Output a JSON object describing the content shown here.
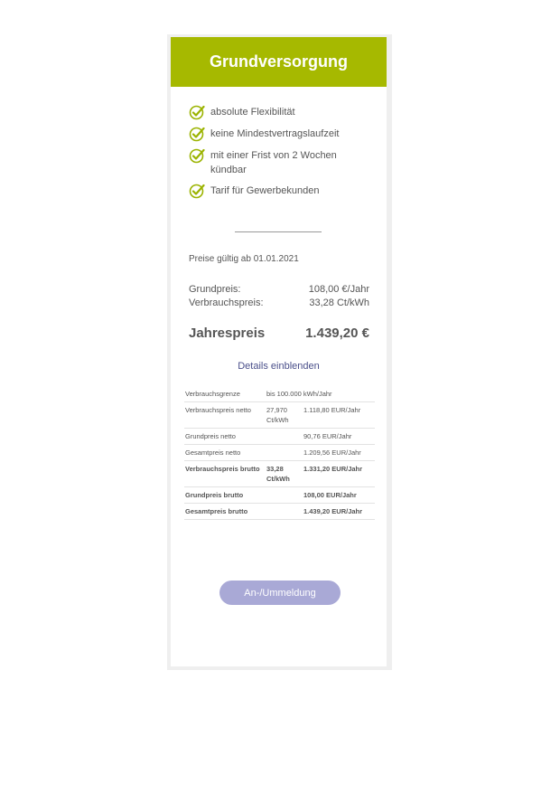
{
  "tariff": {
    "title": "Grundversorgung",
    "features": [
      {
        "label": "absolute Flexibilität"
      },
      {
        "label": "keine Mindestvertragslaufzeit"
      },
      {
        "label": "mit einer Frist von 2 Wochen kündbar"
      },
      {
        "label": "Tarif für Gewerbekunden"
      }
    ],
    "valid_from": "Preise gültig ab 01.01.2021",
    "base_price": {
      "label": "Grundpreis:",
      "value": "108,00 €/Jahr"
    },
    "usage_price": {
      "label": "Verbrauchspreis:",
      "value": "33,28 Ct/kWh"
    },
    "annual_price": {
      "label": "Jahrespreis",
      "value": "1.439,20 €"
    },
    "details_link": "Details einblenden",
    "details_rows": [
      {
        "label": "Verbrauchsgrenze",
        "unit_price": "bis 100.000 kWh/Jahr",
        "total": "",
        "bold": false,
        "span": true
      },
      {
        "label": "Verbrauchspreis netto",
        "unit_price": "27,970 Ct/kWh",
        "total": "1.118,80 EUR/Jahr",
        "bold": false
      },
      {
        "label": "Grundpreis netto",
        "unit_price": "",
        "total": "90,76 EUR/Jahr",
        "bold": false
      },
      {
        "label": "Gesamtpreis netto",
        "unit_price": "",
        "total": "1.209,56 EUR/Jahr",
        "bold": false
      },
      {
        "label": "Verbrauchspreis brutto",
        "unit_price": "33,28 Ct/kWh",
        "total": "1.331,20 EUR/Jahr",
        "bold": true
      },
      {
        "label": "Grundpreis brutto",
        "unit_price": "",
        "total": "108,00 EUR/Jahr",
        "bold": true
      },
      {
        "label": "Gesamtpreis brutto",
        "unit_price": "",
        "total": "1.439,20 EUR/Jahr",
        "bold": true
      }
    ],
    "button_label": "An-/Ummeldung",
    "colors": {
      "header": "#a6b900",
      "check": "#9bb300",
      "link": "#4a4f8a",
      "button": "#a9a9d6"
    },
    "feature_icon": "check-circle-icon"
  }
}
